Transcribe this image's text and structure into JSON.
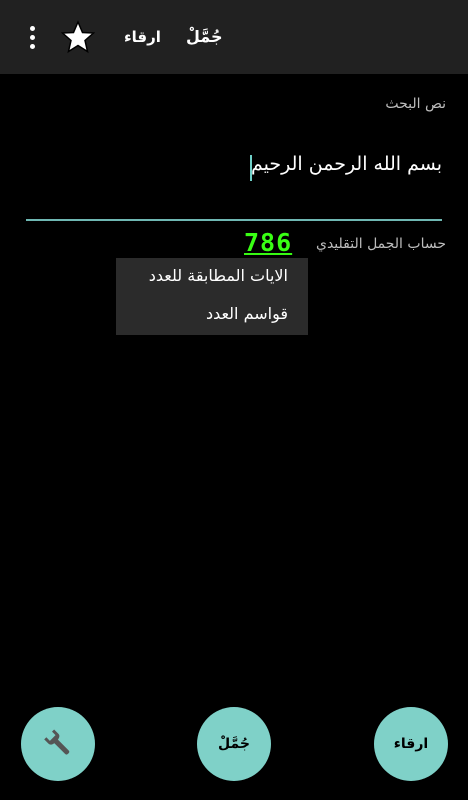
{
  "toolbar": {
    "menu_icon": "more-vertical-icon",
    "star_icon": "star-icon",
    "irqaa_label": "ارقاء",
    "jummal_label": "جُمَّلْ"
  },
  "search": {
    "label": "نص البحث",
    "value": "بسم الله الرحمن الرحيم"
  },
  "calc": {
    "label": "حساب الجمل التقليدي",
    "value": "786"
  },
  "popup": {
    "items": [
      "الايات المطابقة للعدد",
      "قواسم العدد"
    ]
  },
  "fabs": {
    "tools_icon": "wrench-icon",
    "jummal_label": "جُمَّلْ",
    "irqaa_label": "ارقاء"
  },
  "colors": {
    "toolbar_bg": "#212121",
    "accent": "#7fd1c8",
    "value_green": "#39ff14"
  }
}
